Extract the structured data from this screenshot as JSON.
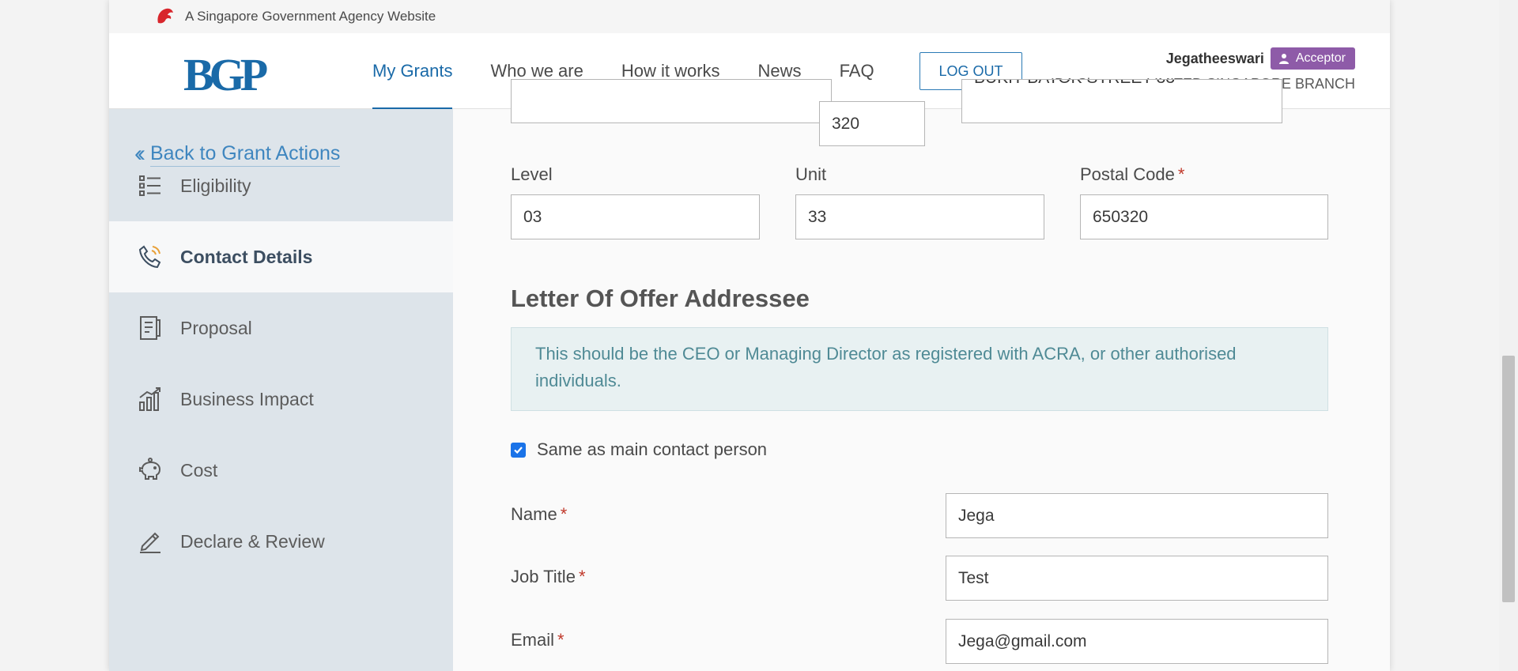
{
  "gov_bar": {
    "text": "A Singapore Government Agency Website"
  },
  "header": {
    "logo": "BGP",
    "nav": [
      {
        "label": "My Grants",
        "active": true
      },
      {
        "label": "Who we are",
        "active": false
      },
      {
        "label": "How it works",
        "active": false
      },
      {
        "label": "News",
        "active": false
      },
      {
        "label": "FAQ",
        "active": false
      }
    ],
    "logout_label": "LOG OUT",
    "user_name": "Jegatheeswari",
    "role": "Acceptor",
    "company": "IDA Singapore LIMITED SINGAPORE BRANCH"
  },
  "sidebar": {
    "back_label": "Back to Grant Actions",
    "items": [
      {
        "label": "Eligibility",
        "icon": "list-icon"
      },
      {
        "label": "Contact Details",
        "icon": "phone-icon",
        "active": true
      },
      {
        "label": "Proposal",
        "icon": "document-icon"
      },
      {
        "label": "Business Impact",
        "icon": "chart-icon"
      },
      {
        "label": "Cost",
        "icon": "piggy-bank-icon"
      },
      {
        "label": "Declare & Review",
        "icon": "pen-icon"
      }
    ]
  },
  "address": {
    "block_value": "320",
    "street_value": "BUKIT BATOK STREET 33",
    "level_label": "Level",
    "level_value": "03",
    "unit_label": "Unit",
    "unit_value": "33",
    "postal_label": "Postal Code",
    "postal_value": "650320"
  },
  "addressee": {
    "title": "Letter Of Offer Addressee",
    "info": "This should be the CEO or Managing Director as registered with ACRA, or other authorised individuals.",
    "same_as_label": "Same as main contact person",
    "same_as_checked": true,
    "name_label": "Name",
    "name_value": "Jega",
    "job_label": "Job Title",
    "job_value": "Test",
    "email_label": "Email",
    "email_value": "Jega@gmail.com"
  },
  "colors": {
    "brand": "#1a6aa8",
    "sidebar_bg": "#dde4ea",
    "role_badge": "#8e5ba8",
    "info_bg": "#e8f1f2",
    "info_text": "#4f8a95",
    "required": "#c0392b"
  }
}
